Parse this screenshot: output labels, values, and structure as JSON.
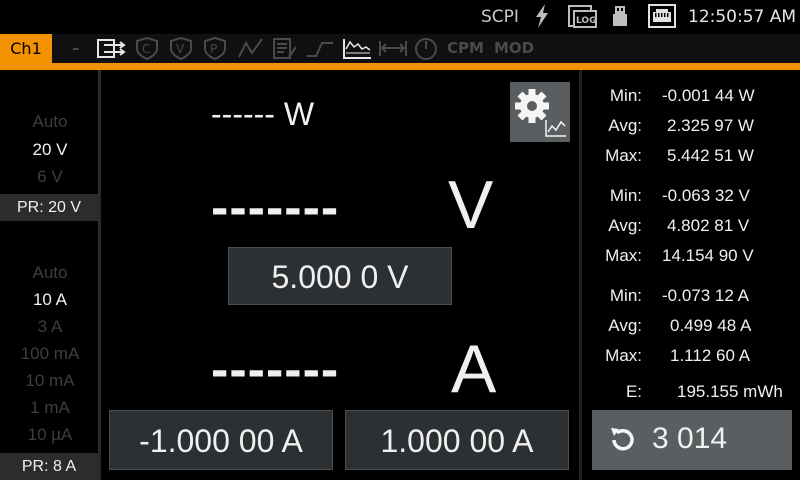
{
  "status": {
    "scpi": "SCPI",
    "log_icon": "LOG",
    "time": "12:50:57 AM"
  },
  "channel": {
    "tab": "Ch1",
    "dash": "–",
    "cpm": "CPM",
    "mod": "MOD"
  },
  "voltage_ranges": {
    "items": [
      "Auto",
      "20 V",
      "6 V"
    ],
    "selected": "20 V",
    "pr": "PR: 20 V"
  },
  "current_ranges": {
    "items": [
      "Auto",
      "10 A",
      "3 A",
      "100 mA",
      "10 mA",
      "1 mA",
      "10 µA"
    ],
    "selected": "10 A",
    "pr": "PR: 8 A"
  },
  "measure": {
    "power": "------ W",
    "voltage_dashes": "-------",
    "voltage_unit": "V",
    "current_dashes": "-------",
    "current_unit": "A"
  },
  "setpoints": {
    "voltage": "5.000 0  V",
    "current_low": "-1.000 00  A",
    "current_high": "1.000 00  A"
  },
  "stats": {
    "power": [
      {
        "label": "Min:",
        "value": "-0.001 44 W"
      },
      {
        "label": "Avg:",
        "value": "2.325 97 W"
      },
      {
        "label": "Max:",
        "value": "5.442 51 W"
      }
    ],
    "voltage": [
      {
        "label": "Min:",
        "value": "-0.063 32 V"
      },
      {
        "label": "Avg:",
        "value": "4.802 81 V"
      },
      {
        "label": "Max:",
        "value": "14.154 90 V"
      }
    ],
    "current": [
      {
        "label": "Min:",
        "value": "-0.073 12 A"
      },
      {
        "label": "Avg:",
        "value": "0.499 48 A"
      },
      {
        "label": "Max:",
        "value": "1.112 60 A"
      }
    ],
    "energy": {
      "label": "E:",
      "value": "195.155 mWh"
    },
    "counter": "3 014"
  },
  "colors": {
    "accent": "#f39200",
    "button": "#5a5e61",
    "setbox": "#2c3033"
  }
}
